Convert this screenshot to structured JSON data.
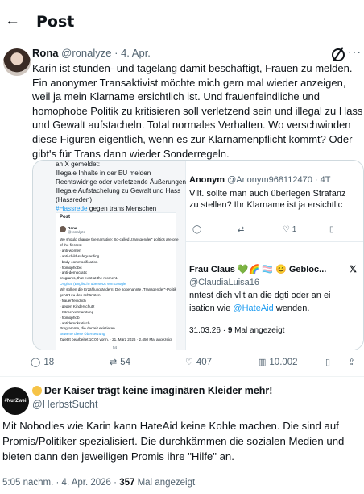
{
  "header": {
    "title": "Post"
  },
  "post1": {
    "author_name": "Rona",
    "handle": "@ronalyze",
    "date": "4. Apr.",
    "text": "Karin ist stunden- und tagelang damit beschäftigt, Frauen zu melden. Ein anonymer Transaktivist möchte mich gern mal wieder anzeigen, weil ja mein Klarname ersichtlich ist. Und frauenfeindliche und homophobe Politik zu kritisieren soll verletzend sein und illegal zu Hass und Gewalt aufstacheln. Total normales Verhalten. Wo verschwinden diese Figuren eigentlich, wenn es zur Klarnamenpflicht kommt? Oder gibt's für Trans dann wieder Sonderregeln.",
    "media": {
      "left": {
        "line1": "an X gemeldet:",
        "line2": "Illegale Inhalte in der EU melden",
        "line3": "Rechtswidrige oder verletzende Äußerungen",
        "line4": "Illegale Aufstachelung zu Gewalt und Hass",
        "line5": "(Hassreden)",
        "hashtag": "#Hassrede",
        "line6_rest": " gegen trans Menschen",
        "inner": {
          "title": "Post",
          "name": "Rona",
          "handle": "@ronalyze",
          "lines": [
            "We should change the narrative: So-called „transgender\" politics are one",
            "of the fiercest",
            "- anti-women",
            "- anti-child-safeguarding",
            "- body-commodification",
            "- homophobic",
            "- anti-democratic",
            "programs, that exist at the moment.",
            "Original (Englisch) übersetzt von Google",
            "Wir sollten die Erzählung ändern: Die sogenannte „Transgender\"-Politik",
            "gehört zu den schärfsten.",
            "- frauenfeindlich",
            "- gegen Kinderschutz",
            "- Körpervermarktung",
            "- homophob",
            "- antidemokratisch",
            "Programme, die derzeit existieren.",
            "Bewerte diese Übersetzung",
            "Zuletzt bearbeitet 10:00 vorm. · 21. März 2026 · 2.450 Mal angezeigt"
          ],
          "counts": [
            "54"
          ]
        }
      },
      "right": {
        "reply1_name": "Anonym",
        "reply1_handle": "@Anonym968112470 · 4T",
        "reply1_line1": "Vllt. sollte man auch überlegen Strafanz",
        "reply1_line2": "zu stellen? Ihr Klarname ist ja ersichtlic",
        "reply1_likes": "1",
        "reply2_name": "Frau Claus 💚🌈 🏳️‍⚧️ 😊 Gebloc...",
        "reply2_handle": "@ClaudiaLuisa16",
        "reply2_line1": "nntest dich vllt an die dgti oder an ei",
        "reply2_line2_pre": "isation wie ",
        "reply2_mention": "@HateAid",
        "reply2_line2_post": " wenden.",
        "reply2_meta_date": "31.03.26 · ",
        "reply2_views": "9",
        "reply2_meta_suffix": " Mal angezeigt"
      }
    },
    "actions": {
      "replies": "18",
      "reposts": "54",
      "likes": "407",
      "views": "10.002"
    }
  },
  "post2": {
    "author_name": "Der Kaiser trägt keine imaginären Kleider mehr!",
    "handle": "@HerbstSucht",
    "avatar_text": "#NurZwei",
    "text": "Mit Nobodies wie Karin kann HateAid keine Kohle machen. Die sind auf Promis/Politiker spezialisiert.  Die durchkämmen die sozialen Medien und bieten dann den jeweiligen Promis ihre \"Hilfe\" an.",
    "time": "5:05 nachm.",
    "date": "4. Apr. 2026",
    "views": "357",
    "views_suffix": "Mal angezeigt"
  }
}
